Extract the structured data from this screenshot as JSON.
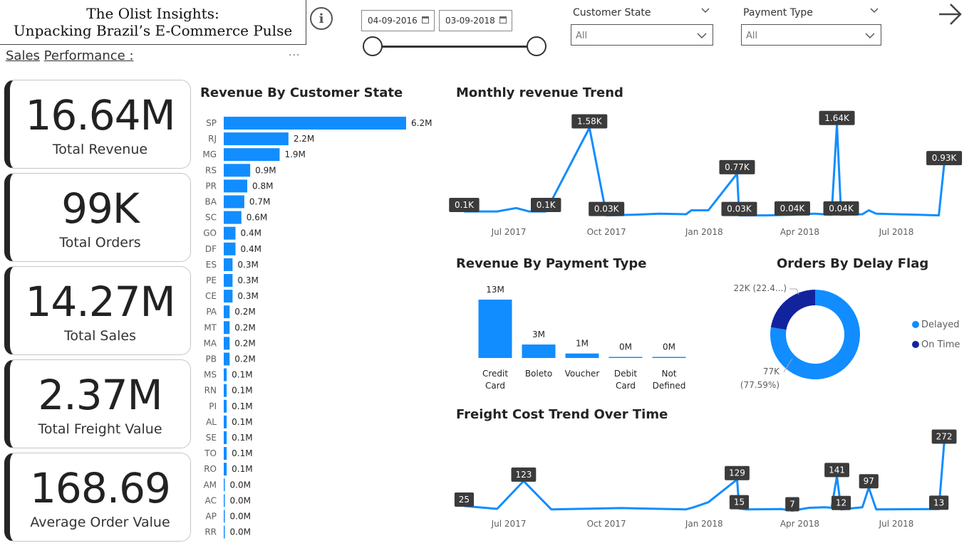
{
  "header": {
    "title_line1": "The Olist Insights:",
    "title_line2": "Unpacking Brazil’s E-Commerce Pulse",
    "section_word1": "Sales",
    "section_word2": "Performance :",
    "more_options": "···"
  },
  "date_range": {
    "start": "04-09-2016",
    "end": "03-09-2018"
  },
  "filters": {
    "customer_state": {
      "label": "Customer State",
      "value": "All"
    },
    "payment_type": {
      "label": "Payment Type",
      "value": "All"
    }
  },
  "kpis": [
    {
      "value": "16.64M",
      "label": "Total Revenue"
    },
    {
      "value": "99K",
      "label": "Total Orders"
    },
    {
      "value": "14.27M",
      "label": "Total Sales"
    },
    {
      "value": "2.37M",
      "label": "Total Freight Value"
    },
    {
      "value": "168.69",
      "label": "Average Order Value"
    }
  ],
  "colors": {
    "bar": "#118dff",
    "dark_blue": "#12239e",
    "tooltip": "#3b3b3b"
  },
  "chart_data": [
    {
      "type": "bar",
      "orientation": "horizontal",
      "title": "Revenue By Customer State",
      "categories": [
        "SP",
        "RJ",
        "MG",
        "RS",
        "PR",
        "BA",
        "SC",
        "GO",
        "DF",
        "ES",
        "PE",
        "CE",
        "PA",
        "MT",
        "MA",
        "PB",
        "MS",
        "RN",
        "PI",
        "AL",
        "SE",
        "TO",
        "RO",
        "AM",
        "AC",
        "AP",
        "RR"
      ],
      "values": [
        6.2,
        2.2,
        1.9,
        0.9,
        0.8,
        0.7,
        0.6,
        0.4,
        0.4,
        0.3,
        0.3,
        0.3,
        0.2,
        0.2,
        0.2,
        0.2,
        0.1,
        0.1,
        0.1,
        0.1,
        0.1,
        0.1,
        0.1,
        0.0,
        0.0,
        0.0,
        0.0
      ],
      "labels": [
        "6.2M",
        "2.2M",
        "1.9M",
        "0.9M",
        "0.8M",
        "0.7M",
        "0.6M",
        "0.4M",
        "0.4M",
        "0.3M",
        "0.3M",
        "0.3M",
        "0.2M",
        "0.2M",
        "0.2M",
        "0.2M",
        "0.1M",
        "0.1M",
        "0.1M",
        "0.1M",
        "0.1M",
        "0.1M",
        "0.1M",
        "0.0M",
        "0.0M",
        "0.0M",
        "0.0M"
      ],
      "unit": "M"
    },
    {
      "type": "line",
      "title": "Monthly revenue Trend",
      "x_ticks": [
        "Jul 2017",
        "Oct 2017",
        "Jan 2018",
        "Apr 2018",
        "Jul 2018"
      ],
      "x_tick_dates": [
        "2017-07-01",
        "2017-10-01",
        "2018-01-01",
        "2018-04-01",
        "2018-07-01"
      ],
      "x_range": [
        "2017-05-15",
        "2018-08-25"
      ],
      "y_range": [
        0,
        1.7
      ],
      "points": [
        [
          "2017-05-20",
          0.1
        ],
        [
          "2017-06-20",
          0.1
        ],
        [
          "2017-07-08",
          0.16
        ],
        [
          "2017-07-20",
          0.1
        ],
        [
          "2017-08-05",
          0.1
        ],
        [
          "2017-09-15",
          1.58
        ],
        [
          "2017-10-01",
          0.03
        ],
        [
          "2017-10-25",
          0.04
        ],
        [
          "2017-11-20",
          0.06
        ],
        [
          "2017-12-15",
          0.05
        ],
        [
          "2017-12-20",
          0.12
        ],
        [
          "2018-01-05",
          0.12
        ],
        [
          "2018-02-01",
          0.77
        ],
        [
          "2018-02-03",
          0.03
        ],
        [
          "2018-03-01",
          0.03
        ],
        [
          "2018-03-25",
          0.04
        ],
        [
          "2018-04-15",
          0.06
        ],
        [
          "2018-05-01",
          0.04
        ],
        [
          "2018-05-06",
          1.64
        ],
        [
          "2018-05-10",
          0.04
        ],
        [
          "2018-05-30",
          0.05
        ],
        [
          "2018-06-05",
          0.12
        ],
        [
          "2018-06-12",
          0.06
        ],
        [
          "2018-08-10",
          0.03
        ],
        [
          "2018-08-15",
          0.93
        ]
      ],
      "data_labels": [
        {
          "x": "2017-05-20",
          "y": 0.1,
          "text": "0.1K"
        },
        {
          "x": "2017-08-05",
          "y": 0.1,
          "text": "0.1K"
        },
        {
          "x": "2017-09-15",
          "y": 1.58,
          "text": "1.58K"
        },
        {
          "x": "2017-10-01",
          "y": 0.03,
          "text": "0.03K"
        },
        {
          "x": "2018-02-01",
          "y": 0.77,
          "text": "0.77K"
        },
        {
          "x": "2018-02-03",
          "y": 0.03,
          "text": "0.03K"
        },
        {
          "x": "2018-03-25",
          "y": 0.04,
          "text": "0.04K"
        },
        {
          "x": "2018-05-06",
          "y": 1.64,
          "text": "1.64K"
        },
        {
          "x": "2018-05-10",
          "y": 0.04,
          "text": "0.04K"
        },
        {
          "x": "2018-08-15",
          "y": 0.93,
          "text": "0.93K"
        }
      ]
    },
    {
      "type": "bar",
      "title": "Revenue By Payment Type",
      "categories": [
        "Credit Card",
        "Boleto",
        "Voucher",
        "Debit Card",
        "Not Defined"
      ],
      "category_lines": [
        [
          "Credit",
          "Card"
        ],
        [
          "Boleto"
        ],
        [
          "Voucher"
        ],
        [
          "Debit",
          "Card"
        ],
        [
          "Not",
          "Defined"
        ]
      ],
      "values": [
        13,
        3,
        1,
        0,
        0
      ],
      "labels": [
        "13M",
        "3M",
        "1M",
        "0M",
        "0M"
      ],
      "unit": "M"
    },
    {
      "type": "pie",
      "variant": "donut",
      "title": "Orders By Delay Flag",
      "slices": [
        {
          "name": "Delayed",
          "value": 77,
          "percent": 77.59,
          "label_value": "77K",
          "label_pct": "(77.59%)",
          "color": "#118dff"
        },
        {
          "name": "On Time",
          "value": 22,
          "percent": 22.41,
          "label_text": "22K (22.4...)",
          "color": "#12239e"
        }
      ],
      "legend": [
        "Delayed",
        "On Time"
      ]
    },
    {
      "type": "line",
      "title": "Freight Cost Trend Over Time",
      "x_ticks": [
        "Jul 2017",
        "Oct 2017",
        "Jan 2018",
        "Apr 2018",
        "Jul 2018"
      ],
      "x_tick_dates": [
        "2017-07-01",
        "2017-10-01",
        "2018-01-01",
        "2018-04-01",
        "2018-07-01"
      ],
      "x_range": [
        "2017-05-15",
        "2018-08-25"
      ],
      "y_range": [
        0,
        290
      ],
      "points": [
        [
          "2017-05-20",
          25
        ],
        [
          "2017-06-20",
          14
        ],
        [
          "2017-07-15",
          123
        ],
        [
          "2017-08-10",
          12
        ],
        [
          "2017-10-15",
          17
        ],
        [
          "2017-12-15",
          12
        ],
        [
          "2017-12-22",
          20
        ],
        [
          "2018-01-05",
          40
        ],
        [
          "2018-02-01",
          129
        ],
        [
          "2018-02-03",
          15
        ],
        [
          "2018-02-10",
          12
        ],
        [
          "2018-03-15",
          13
        ],
        [
          "2018-03-25",
          7
        ],
        [
          "2018-04-10",
          18
        ],
        [
          "2018-04-25",
          20
        ],
        [
          "2018-05-01",
          18
        ],
        [
          "2018-05-06",
          141
        ],
        [
          "2018-05-10",
          12
        ],
        [
          "2018-05-30",
          20
        ],
        [
          "2018-06-05",
          97
        ],
        [
          "2018-06-12",
          12
        ],
        [
          "2018-08-10",
          13
        ],
        [
          "2018-08-15",
          272
        ]
      ],
      "data_labels": [
        {
          "x": "2017-05-20",
          "y": 25,
          "text": "25"
        },
        {
          "x": "2017-07-15",
          "y": 123,
          "text": "123"
        },
        {
          "x": "2018-02-01",
          "y": 129,
          "text": "129"
        },
        {
          "x": "2018-02-03",
          "y": 15,
          "text": "15"
        },
        {
          "x": "2018-03-25",
          "y": 7,
          "text": "7"
        },
        {
          "x": "2018-05-06",
          "y": 141,
          "text": "141"
        },
        {
          "x": "2018-05-10",
          "y": 12,
          "text": "12"
        },
        {
          "x": "2018-06-05",
          "y": 97,
          "text": "97"
        },
        {
          "x": "2018-08-10",
          "y": 13,
          "text": "13"
        },
        {
          "x": "2018-08-15",
          "y": 272,
          "text": "272"
        }
      ]
    }
  ]
}
